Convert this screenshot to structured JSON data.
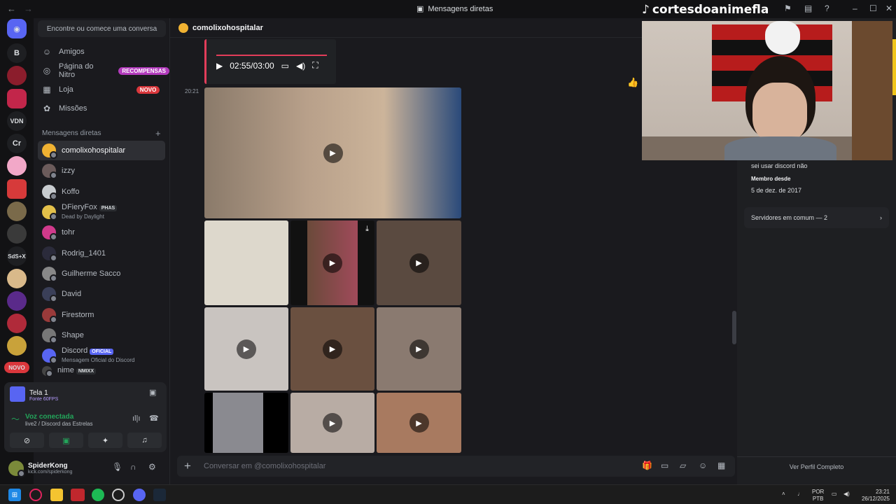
{
  "titlebar": {
    "title": "Mensagens diretas"
  },
  "overlay": {
    "tiktok": "cortesdoanimefla"
  },
  "servers": [
    {
      "label": "B"
    },
    {
      "label": "VDN"
    },
    {
      "label": "Cr"
    },
    {
      "label": "SdS+X"
    }
  ],
  "new_badge": "NOVO",
  "sidebar": {
    "search_placeholder": "Encontre ou comece uma conversa",
    "nav": [
      {
        "label": "Amigos"
      },
      {
        "label": "Página do Nitro",
        "badge": "RECOMPENSAS"
      },
      {
        "label": "Loja",
        "badge": "NOVO"
      },
      {
        "label": "Missões"
      }
    ],
    "dm_header": "Mensagens diretas",
    "dms": [
      {
        "name": "comolixohospitalar"
      },
      {
        "name": "izzy"
      },
      {
        "name": "Koffo"
      },
      {
        "name": "DFieryFox",
        "tag": "PHAS",
        "sub": "Dead by Daylight"
      },
      {
        "name": "tohr"
      },
      {
        "name": "Rodrig_1401"
      },
      {
        "name": "Guilherme Sacco"
      },
      {
        "name": "David"
      },
      {
        "name": "Firestorm"
      },
      {
        "name": "Shape"
      },
      {
        "name": "Discord",
        "tag": "OFICIAL",
        "sub": "Mensagem Oficial do Discord"
      },
      {
        "name": "nime",
        "tag": "NMIXX"
      }
    ]
  },
  "stream_panel": {
    "title": "Tela 1",
    "subtitle": "Fonte 60FPS",
    "voice_status": "Voz conectada",
    "voice_channel": "live2 / Discord das Estrelas"
  },
  "user": {
    "name": "SpiderKong",
    "status": "kick.com/spiderkong"
  },
  "chat": {
    "recipient": "comolixohospitalar",
    "video_time": "02:55/03:00",
    "timestamp": "20:21",
    "input_placeholder": "Conversar em @comolixohospitalar"
  },
  "profile": {
    "bio_fragment": "sei usar discord não",
    "member_since_label": "Membro desde",
    "member_since": "5 de dez. de 2017",
    "common_servers": "Servidores em comum — 2",
    "full_profile": "Ver Perfil Completo"
  },
  "taskbar": {
    "lang": "POR",
    "layout": "PTB",
    "time": "23:21",
    "date": "26/12/2025"
  }
}
